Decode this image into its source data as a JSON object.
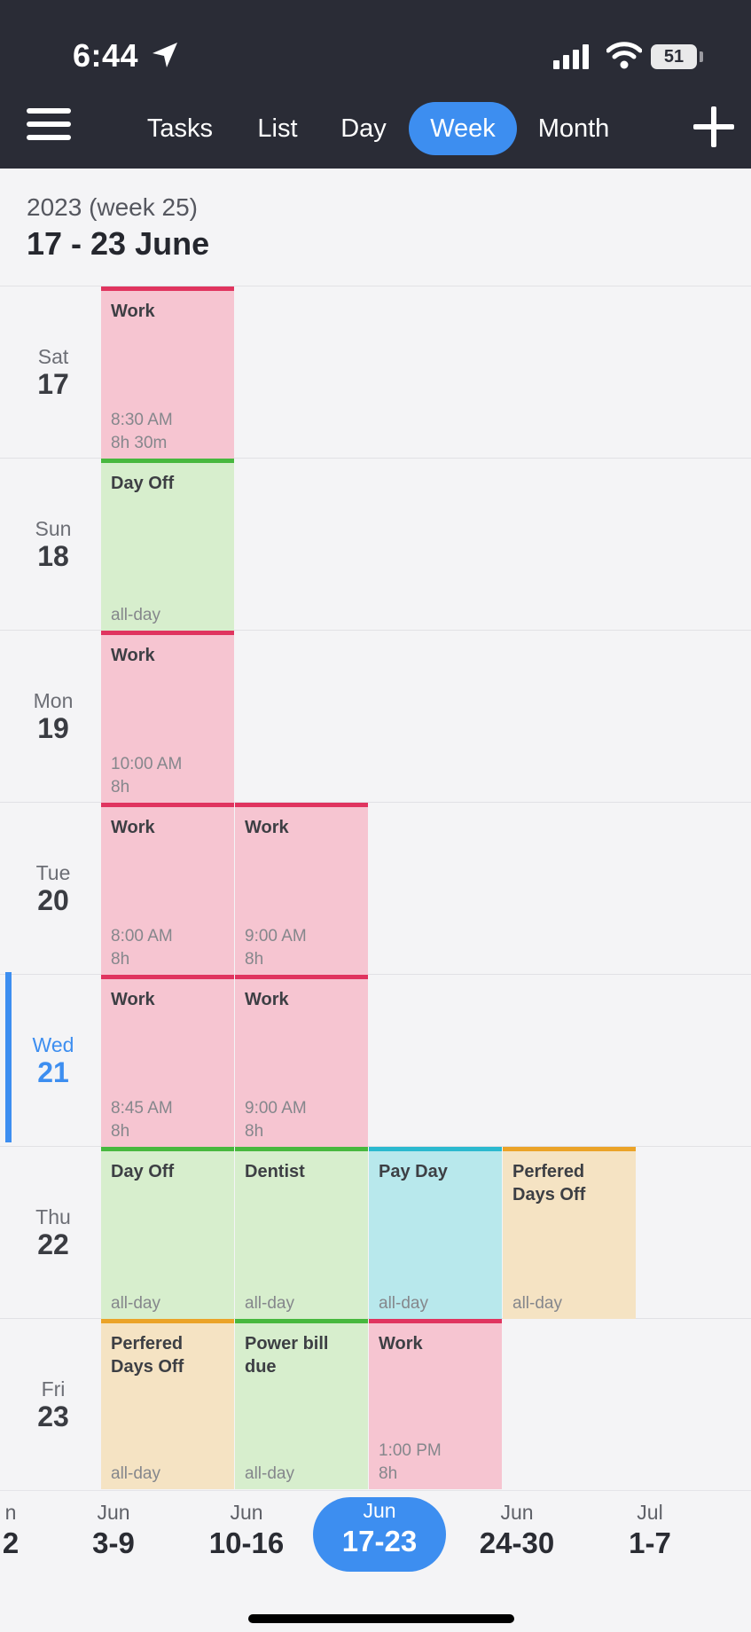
{
  "status_bar": {
    "time": "6:44",
    "battery": "51"
  },
  "nav": {
    "tabs": [
      "Tasks",
      "List",
      "Day",
      "Week",
      "Month"
    ],
    "active_tab": "Week"
  },
  "header": {
    "subtitle": "2023 (week 25)",
    "title": "17 - 23 June"
  },
  "days": [
    {
      "name": "Sat",
      "num": "17"
    },
    {
      "name": "Sun",
      "num": "18"
    },
    {
      "name": "Mon",
      "num": "19"
    },
    {
      "name": "Tue",
      "num": "20"
    },
    {
      "name": "Wed",
      "num": "21"
    },
    {
      "name": "Thu",
      "num": "22"
    },
    {
      "name": "Fri",
      "num": "23"
    }
  ],
  "events": {
    "sat": [
      {
        "title": "Work",
        "time": "8:30 AM",
        "duration": "8h 30m",
        "color": "#e0345f"
      }
    ],
    "sun": [
      {
        "title": "Day Off",
        "time": "all-day",
        "color": "#47b83e"
      }
    ],
    "mon": [
      {
        "title": "Work",
        "time": "10:00 AM",
        "duration": "8h",
        "color": "#e0345f"
      }
    ],
    "tue": [
      {
        "title": "Work",
        "time": "8:00 AM",
        "duration": "8h",
        "color": "#e0345f"
      },
      {
        "title": "Work",
        "time": "9:00 AM",
        "duration": "8h",
        "color": "#e0345f"
      }
    ],
    "wed": [
      {
        "title": "Work",
        "time": "8:45 AM",
        "duration": "8h",
        "color": "#e0345f"
      },
      {
        "title": "Work",
        "time": "9:00 AM",
        "duration": "8h",
        "color": "#e0345f"
      }
    ],
    "thu": [
      {
        "title": "Day Off",
        "time": "all-day",
        "color": "#47b83e"
      },
      {
        "title": "Dentist",
        "time": "all-day",
        "color": "#47b83e"
      },
      {
        "title": "Pay Day",
        "time": "all-day",
        "color": "#2bb9cf"
      },
      {
        "title": "Perfered Days Off",
        "time": "all-day",
        "color": "#eba328"
      }
    ],
    "fri": [
      {
        "title": "Perfered Days Off",
        "time": "all-day",
        "color": "#eba328"
      },
      {
        "title": "Power bill due",
        "time": "all-day",
        "color": "#47b83e"
      },
      {
        "title": "Work",
        "time": "1:00 PM",
        "duration": "8h",
        "color": "#e0345f"
      }
    ]
  },
  "week_selector": [
    {
      "month": "n",
      "range": "2"
    },
    {
      "month": "Jun",
      "range": "3-9"
    },
    {
      "month": "Jun",
      "range": "10-16"
    },
    {
      "month": "Jun",
      "range": "17-23"
    },
    {
      "month": "Jun",
      "range": "24-30"
    },
    {
      "month": "Jul",
      "range": "1-7"
    }
  ],
  "colors": {
    "accent": "#3d8ef0",
    "topbar": "#2a2c36"
  }
}
